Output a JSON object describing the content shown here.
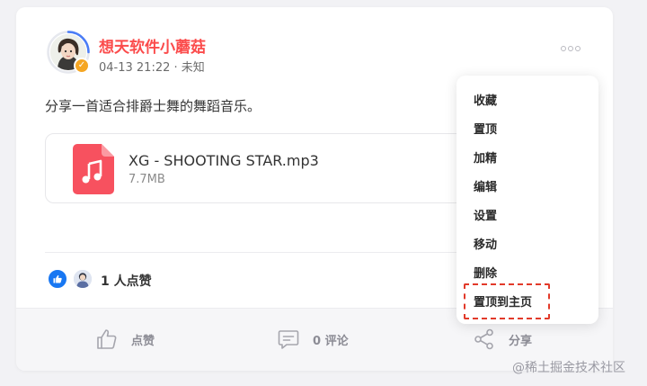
{
  "post": {
    "author": "想天软件小蘑菇",
    "meta": "04-13 21:22 · 未知",
    "text": "分享一首适合排爵士舞的舞蹈音乐。",
    "badge_icon": "verified-check-icon",
    "more_icon": "more-dots-icon"
  },
  "attachment": {
    "file_name": "XG - SHOOTING STAR.mp3",
    "file_size": "7.7MB",
    "icon": "music-file-icon",
    "icon_color": "#f7515f"
  },
  "likes": {
    "summary": "1 人点赞"
  },
  "actions": {
    "like_label": "点赞",
    "comment_label": "0 评论",
    "share_label": "分享"
  },
  "menu": {
    "items": [
      "收藏",
      "置顶",
      "加精",
      "编辑",
      "设置",
      "移动",
      "删除",
      "置顶到主页"
    ],
    "highlighted_item": "置顶到主页",
    "highlight_color": "#e23a2a"
  },
  "watermark": "@稀土掘金技术社区",
  "colors": {
    "author_name": "#fb4b4b",
    "ring": "#4a7cf6",
    "badge": "#f5a623",
    "like_blue": "#1877f2"
  }
}
